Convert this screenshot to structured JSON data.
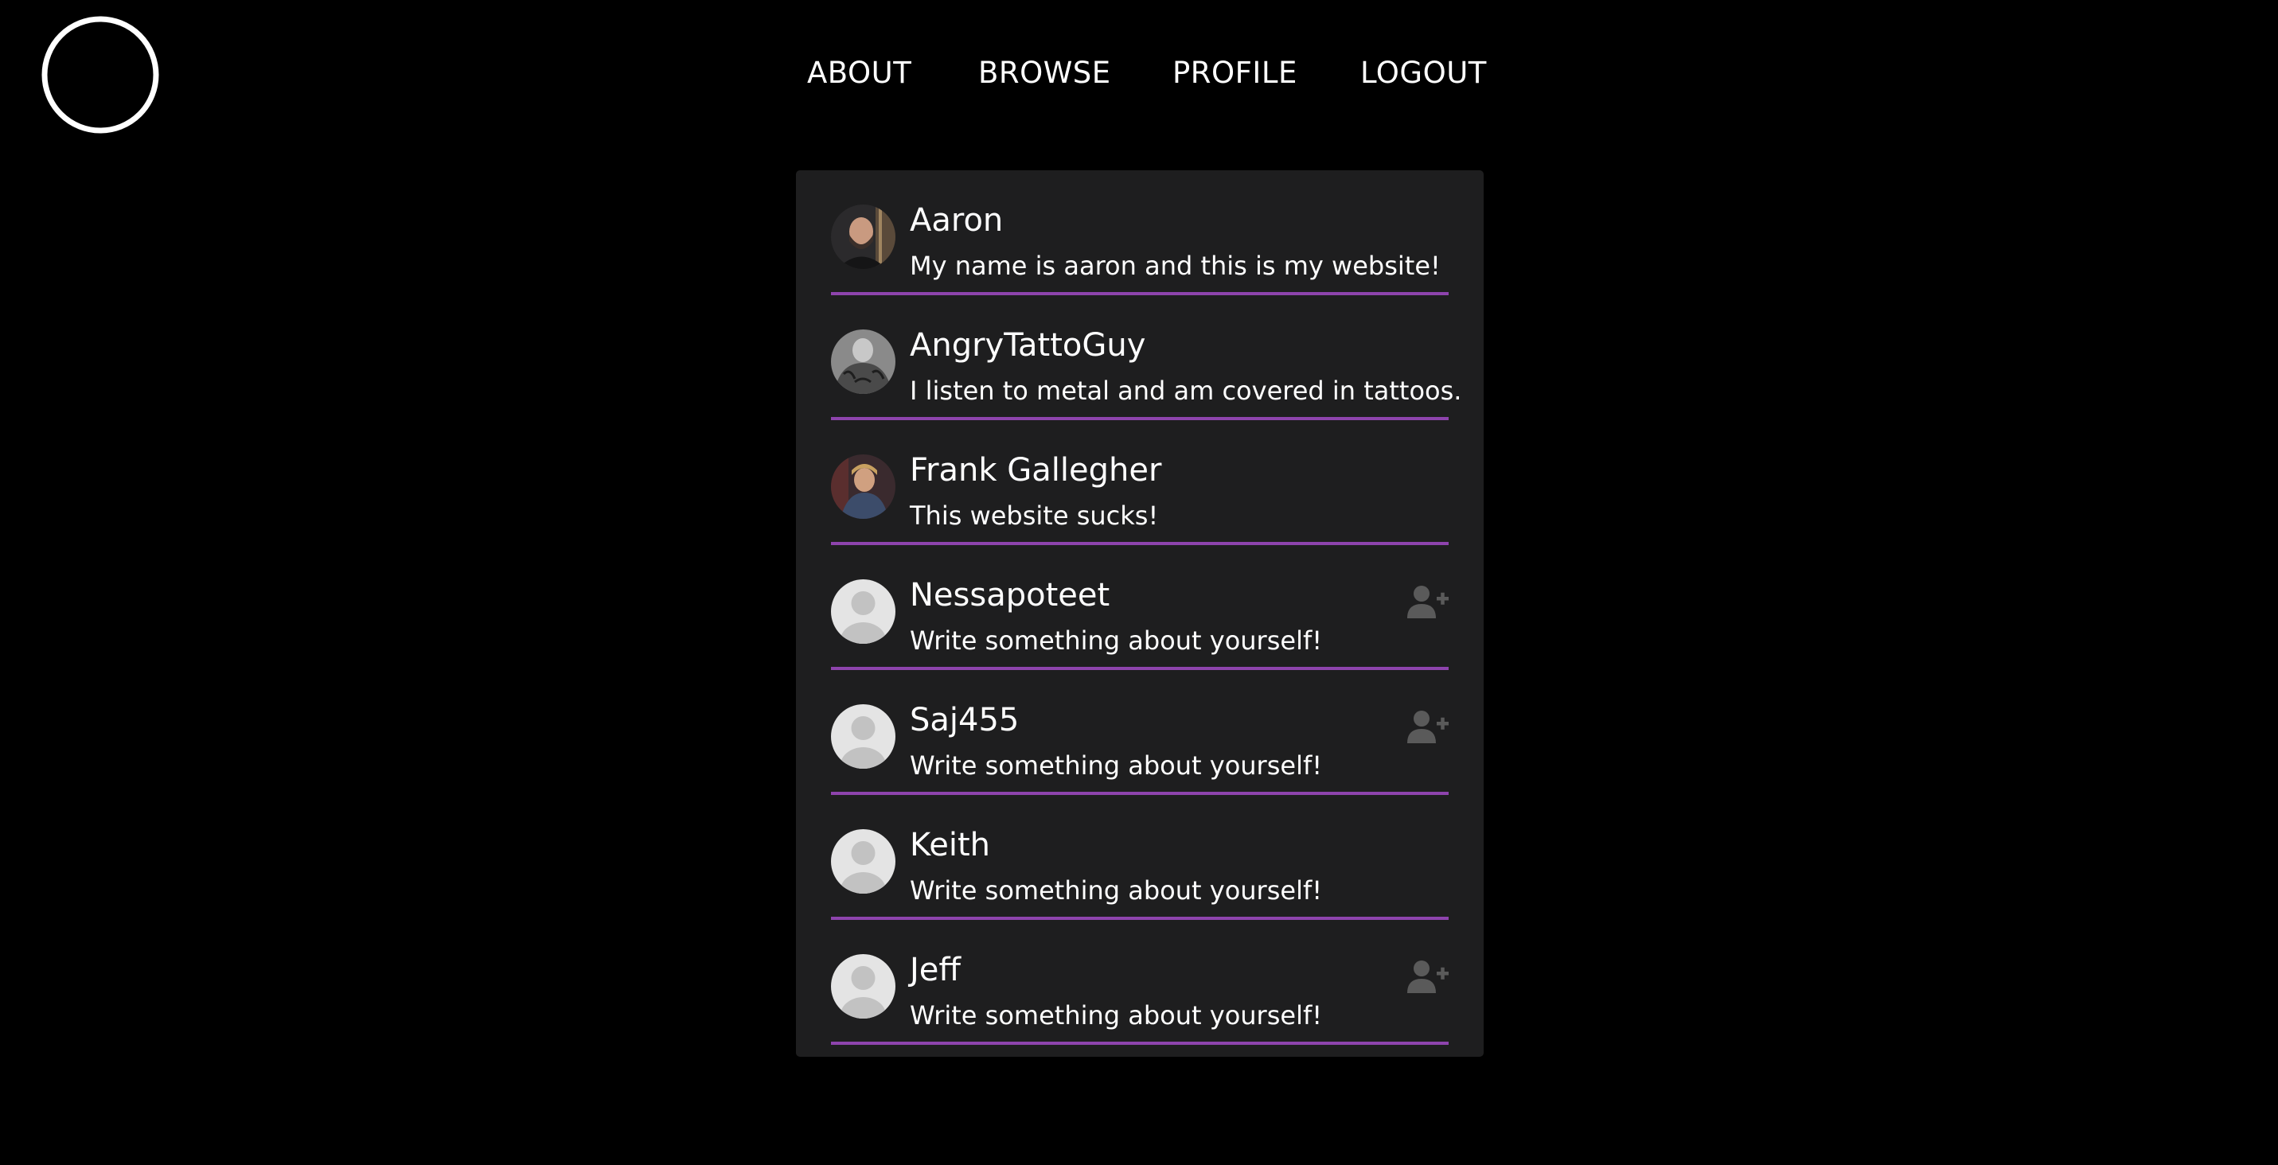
{
  "nav": {
    "items": [
      "ABOUT",
      "BROWSE",
      "PROFILE",
      "LOGOUT"
    ]
  },
  "colors": {
    "background": "#000000",
    "panel": "#1e1e1f",
    "divider": "#8e44ad",
    "text": "#ffffff",
    "add_icon": "#5a5a5a"
  },
  "icons": {
    "logo": "ring-logo-icon",
    "add_friend": "user-plus-icon",
    "default_avatar": "default-avatar-icon"
  },
  "users": [
    {
      "name": "Aaron",
      "bio": "My name is aaron and this is my website!",
      "avatar": "photo",
      "show_add": false
    },
    {
      "name": "AngryTattoGuy",
      "bio": "I listen to metal and am covered in tattoos.",
      "avatar": "photo",
      "show_add": false
    },
    {
      "name": "Frank Gallegher",
      "bio": "This website sucks!",
      "avatar": "photo",
      "show_add": false
    },
    {
      "name": "Nessapoteet",
      "bio": "Write something about yourself!",
      "avatar": "default",
      "show_add": true
    },
    {
      "name": "Saj455",
      "bio": "Write something about yourself!",
      "avatar": "default",
      "show_add": true
    },
    {
      "name": "Keith",
      "bio": "Write something about yourself!",
      "avatar": "default",
      "show_add": false
    },
    {
      "name": "Jeff",
      "bio": "Write something about yourself!",
      "avatar": "default",
      "show_add": true
    }
  ]
}
